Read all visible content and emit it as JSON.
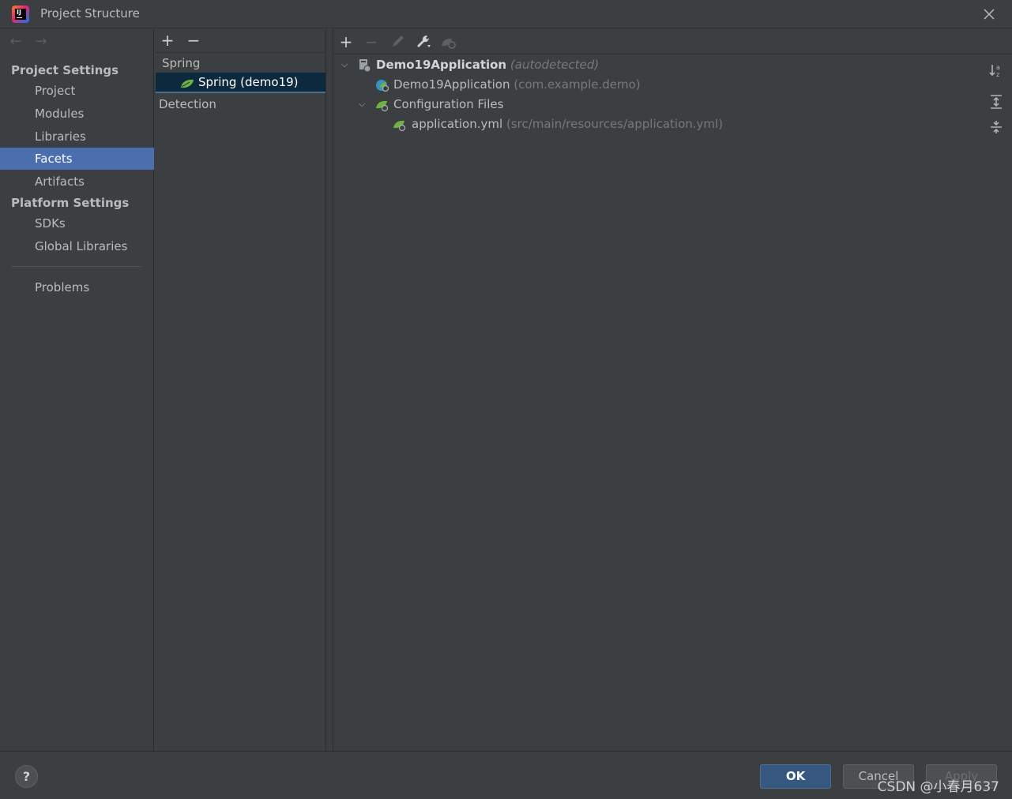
{
  "window": {
    "title": "Project Structure"
  },
  "nav": {
    "back_arrow": "←",
    "forward_arrow": "→",
    "project_settings_header": "Project Settings",
    "project_items": [
      "Project",
      "Modules",
      "Libraries",
      "Facets",
      "Artifacts"
    ],
    "selected_item": "Facets",
    "platform_settings_header": "Platform Settings",
    "platform_items": [
      "SDKs",
      "Global Libraries"
    ],
    "problems": "Problems"
  },
  "facets_panel": {
    "add_icon": "+",
    "remove_icon": "−",
    "group_label": "Spring",
    "selected_facet": "Spring (demo19)",
    "detection_label": "Detection"
  },
  "tree": {
    "root_name": "Demo19Application",
    "root_note": "(autodetected)",
    "app_class": "Demo19Application",
    "app_package": "(com.example.demo)",
    "config_folder": "Configuration Files",
    "config_file": "application.yml",
    "config_path": "(src/main/resources/application.yml)"
  },
  "right_toolbar": [
    "add-icon",
    "remove-icon",
    "edit-icon",
    "wrench-icon",
    "spring-config-icon"
  ],
  "side_toolbar": [
    "sort-icon",
    "expand-all-icon",
    "collapse-all-icon"
  ],
  "footer": {
    "help": "?",
    "ok": "OK",
    "cancel": "Cancel",
    "apply": "Apply",
    "watermark": "CSDN @小春月637"
  },
  "colors": {
    "background": "#3c3f41",
    "selection": "#4b6eaf",
    "tree_selection": "#0d293e",
    "ok_button": "#365880",
    "spring_green": "#6db33f"
  }
}
